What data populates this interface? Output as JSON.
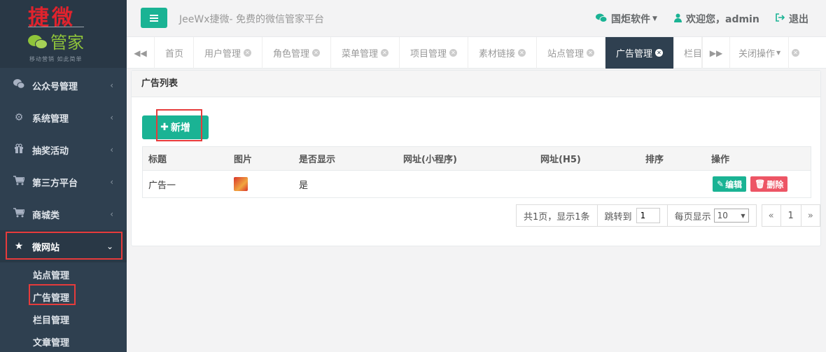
{
  "logo": {
    "title": "捷微",
    "subtitle": "管家",
    "slogan": "移动营销 如此简单"
  },
  "sidebar": {
    "items": [
      {
        "label": "公众号管理",
        "icon": "wechat-icon"
      },
      {
        "label": "系统管理",
        "icon": "gear-icon"
      },
      {
        "label": "抽奖活动",
        "icon": "gift-icon"
      },
      {
        "label": "第三方平台",
        "icon": "cart-icon"
      },
      {
        "label": "商城类",
        "icon": "cart-icon"
      },
      {
        "label": "微网站",
        "icon": "star-icon",
        "active": true
      }
    ],
    "subitems": [
      "站点管理",
      "广告管理",
      "栏目管理",
      "文章管理"
    ]
  },
  "topbar": {
    "platform": "JeeWx捷微- 免费的微信管家平台",
    "company": "国炬软件",
    "welcome": "欢迎您，admin",
    "logout": "退出"
  },
  "tabs": [
    {
      "label": "首页",
      "closable": false
    },
    {
      "label": "用户管理",
      "closable": true
    },
    {
      "label": "角色管理",
      "closable": true
    },
    {
      "label": "菜单管理",
      "closable": true
    },
    {
      "label": "项目管理",
      "closable": true
    },
    {
      "label": "素材链接",
      "closable": true
    },
    {
      "label": "站点管理",
      "closable": true
    },
    {
      "label": "广告管理",
      "closable": true,
      "active": true
    },
    {
      "label": "栏目",
      "closable": false
    }
  ],
  "tab_close_ops": "关闭操作",
  "panel": {
    "title": "广告列表",
    "add_label": "新增",
    "columns": [
      "标题",
      "图片",
      "是否显示",
      "网址(小程序)",
      "网址(H5)",
      "排序",
      "操作"
    ],
    "rows": [
      {
        "title": "广告一",
        "visible": "是",
        "edit": "编辑",
        "delete": "删除"
      }
    ]
  },
  "pager": {
    "summary": "共1页，显示1条",
    "jump_label": "跳转到",
    "jump_value": "1",
    "per_page_label": "每页显示",
    "per_page_value": "10",
    "prev": "«",
    "page": "1",
    "next": "»"
  },
  "colors": {
    "primary": "#1ab394",
    "danger": "#ed5565",
    "sidebar": "#2f4050",
    "highlight_box": "#e63b3b"
  }
}
